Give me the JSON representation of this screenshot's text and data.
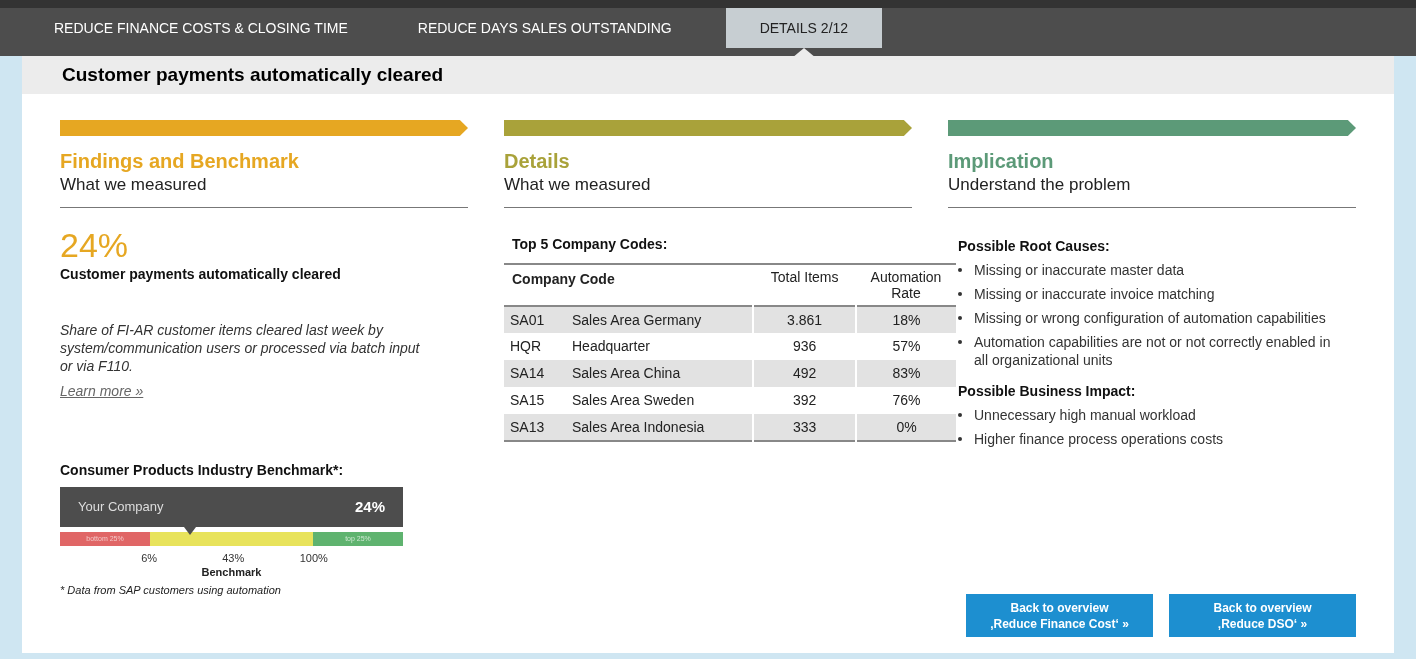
{
  "tabs": [
    {
      "label": "REDUCE FINANCE COSTS & CLOSING TIME",
      "selected": false
    },
    {
      "label": "REDUCE DAYS SALES OUTSTANDING",
      "selected": false
    },
    {
      "label": "DETAILS 2/12",
      "selected": true
    }
  ],
  "title": "Customer payments automatically cleared",
  "columns": [
    {
      "heading": "Findings and Benchmark",
      "subheading": "What we measured",
      "color": "#e6a722"
    },
    {
      "heading": "Details",
      "subheading": "What we measured",
      "color": "#a9a23a"
    },
    {
      "heading": "Implication",
      "subheading": "Understand the problem",
      "color": "#5c9a78"
    }
  ],
  "findings": {
    "value": "24%",
    "label": "Customer payments automatically cleared",
    "description": "Share of FI-AR customer items cleared last week by system/communication users or processed via batch input or via F110.",
    "link": "Learn more »"
  },
  "benchmark": {
    "title": "Consumer Products Industry Benchmark*:",
    "company_label": "Your Company",
    "company_value": "24%",
    "bottom_label": "bottom 25%",
    "top_label": "top 25%",
    "ticks": [
      "6%",
      "43%",
      "100%"
    ],
    "axis_label": "Benchmark",
    "footnote": "* Data from SAP customers using automation"
  },
  "table": {
    "title": "Top 5 Company Codes:",
    "columns": [
      "Company Code",
      "Total Items",
      "Automation Rate"
    ],
    "rows": [
      {
        "code": "SA01",
        "name": "Sales Area Germany",
        "total": "3.861",
        "rate": "18%"
      },
      {
        "code": "HQR",
        "name": "Headquarter",
        "total": "936",
        "rate": "57%"
      },
      {
        "code": "SA14",
        "name": "Sales Area China",
        "total": "492",
        "rate": "83%"
      },
      {
        "code": "SA15",
        "name": "Sales Area Sweden",
        "total": "392",
        "rate": "76%"
      },
      {
        "code": "SA13",
        "name": "Sales Area Indonesia",
        "total": "333",
        "rate": "0%"
      }
    ]
  },
  "implication": {
    "root_causes_title": "Possible Root Causes:",
    "root_causes": [
      "Missing or inaccurate master data",
      "Missing or inaccurate invoice matching",
      "Missing or wrong configuration of automation capabilities",
      "Automation capabilities are not or not correctly enabled in all organizational units"
    ],
    "impact_title": "Possible Business Impact:",
    "impacts": [
      "Unnecessary high manual workload",
      "Higher finance process operations costs"
    ]
  },
  "buttons": [
    {
      "line1": "Back to overview",
      "line2": "‚Reduce Finance Cost‘ »"
    },
    {
      "line1": "Back to overview",
      "line2": "‚Reduce DSO‘ »"
    }
  ]
}
